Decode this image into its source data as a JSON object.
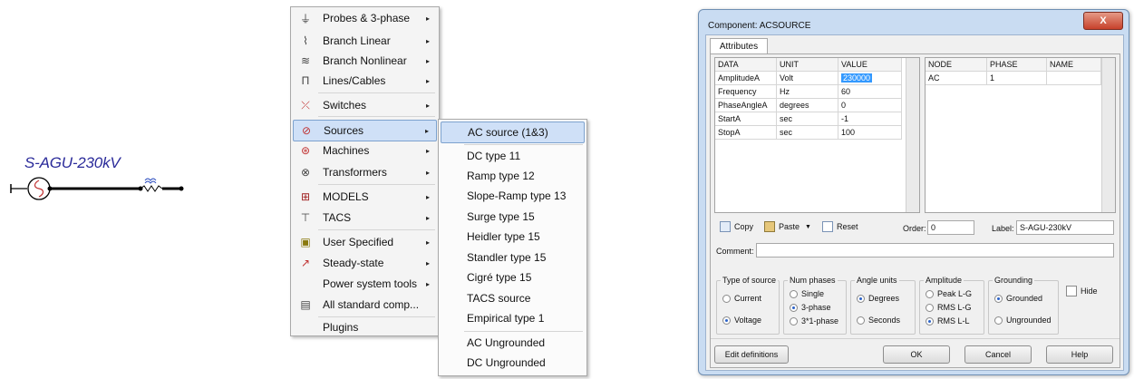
{
  "schematic": {
    "component_label": "S-AGU-230kV"
  },
  "main_menu": {
    "items": [
      {
        "label": "Probes & 3-phase",
        "icon": "probe-icon",
        "arrow": "▸"
      },
      {
        "label": "Branch Linear",
        "icon": "branch-linear-icon",
        "arrow": "▸"
      },
      {
        "label": "Branch Nonlinear",
        "icon": "branch-nonlinear-icon",
        "arrow": "▸"
      },
      {
        "label": "Lines/Cables",
        "icon": "lines-cables-icon",
        "arrow": "▸"
      },
      {
        "label": "Switches",
        "icon": "switch-icon",
        "arrow": "▸"
      },
      {
        "label": "Sources",
        "icon": "source-icon",
        "arrow": "▸",
        "selected": true
      },
      {
        "label": "Machines",
        "icon": "machine-icon",
        "arrow": "▸"
      },
      {
        "label": "Transformers",
        "icon": "transformer-icon",
        "arrow": "▸"
      },
      {
        "label": "MODELS",
        "icon": "models-icon",
        "arrow": "▸"
      },
      {
        "label": "TACS",
        "icon": "tacs-icon",
        "arrow": "▸"
      },
      {
        "label": "User Specified",
        "icon": "user-specified-icon",
        "arrow": "▸"
      },
      {
        "label": "Steady-state",
        "icon": "steady-state-icon",
        "arrow": "▸"
      },
      {
        "label": "Power system tools",
        "icon": "",
        "arrow": "▸"
      },
      {
        "label": "All standard comp...",
        "icon": "all-standard-icon",
        "arrow": ""
      },
      {
        "label": "Plugins",
        "icon": "",
        "arrow": ""
      }
    ]
  },
  "sub_menu": {
    "items": [
      {
        "label": "AC source (1&3)",
        "selected": true
      },
      {
        "label": "DC type 11"
      },
      {
        "label": "Ramp type 12"
      },
      {
        "label": "Slope-Ramp type 13"
      },
      {
        "label": "Surge type 15"
      },
      {
        "label": "Heidler type 15"
      },
      {
        "label": "Standler type 15"
      },
      {
        "label": "Cigré type 15"
      },
      {
        "label": "TACS source"
      },
      {
        "label": "Empirical type 1"
      },
      {
        "label": "AC Ungrounded"
      },
      {
        "label": "DC Ungrounded"
      }
    ]
  },
  "dialog": {
    "title": "Component: ACSOURCE",
    "close_label": "X",
    "tab_label": "Attributes",
    "data_headers": [
      "DATA",
      "UNIT",
      "VALUE"
    ],
    "data_rows": [
      [
        "AmplitudeA",
        "Volt",
        "230000"
      ],
      [
        "Frequency",
        "Hz",
        "60"
      ],
      [
        "PhaseAngleA",
        "degrees",
        "0"
      ],
      [
        "StartA",
        "sec",
        "-1"
      ],
      [
        "StopA",
        "sec",
        "100"
      ]
    ],
    "node_headers": [
      "NODE",
      "PHASE",
      "NAME"
    ],
    "node_rows": [
      [
        "AC",
        "1",
        ""
      ]
    ],
    "copy_label": "Copy",
    "paste_label": "Paste",
    "paste_arrow": "▼",
    "reset_label": "Reset",
    "order_label": "Order:",
    "order_value": "0",
    "label_label": "Label:",
    "label_value": "S-AGU-230kV",
    "comment_label": "Comment:",
    "comment_value": "",
    "groups": {
      "type_of_source": {
        "title": "Type of source",
        "options": [
          "Current",
          "Voltage"
        ],
        "selected": "Voltage"
      },
      "num_phases": {
        "title": "Num phases",
        "options": [
          "Single",
          "3-phase",
          "3*1-phase"
        ],
        "selected": "3-phase"
      },
      "angle_units": {
        "title": "Angle units",
        "options": [
          "Degrees",
          "Seconds"
        ],
        "selected": "Degrees"
      },
      "amplitude": {
        "title": "Amplitude",
        "options": [
          "Peak L-G",
          "RMS L-G",
          "RMS L-L"
        ],
        "selected": "RMS L-L"
      },
      "grounding": {
        "title": "Grounding",
        "options": [
          "Grounded",
          "Ungrounded"
        ],
        "selected": "Grounded"
      }
    },
    "hide_label": "Hide",
    "buttons": {
      "edit_definitions": "Edit definitions",
      "ok": "OK",
      "cancel": "Cancel",
      "help": "Help"
    }
  }
}
